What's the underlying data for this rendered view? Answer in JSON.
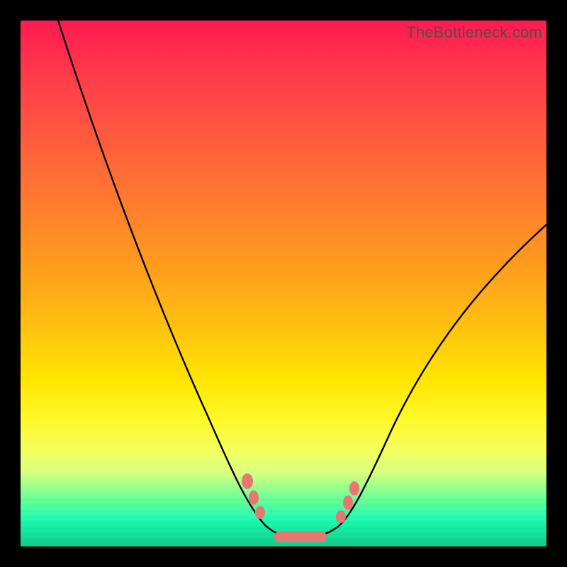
{
  "watermark": "TheBottleneck.com",
  "chart_data": {
    "type": "line",
    "title": "",
    "xlabel": "",
    "ylabel": "",
    "xlim": [
      0,
      100
    ],
    "ylim": [
      0,
      100
    ],
    "grid": false,
    "legend": false,
    "series": [
      {
        "name": "bottleneck-curve",
        "x": [
          7,
          10,
          14,
          18,
          22,
          26,
          30,
          34,
          38,
          41,
          43.5,
          46,
          49,
          52,
          55,
          58,
          61,
          63,
          66,
          70,
          75,
          80,
          85,
          90,
          95,
          100
        ],
        "y": [
          100,
          92,
          83.5,
          75,
          66,
          57,
          48,
          39,
          30,
          21,
          13,
          6.5,
          2.5,
          1.5,
          1.5,
          2.5,
          5,
          9,
          15,
          22,
          30,
          37,
          43.5,
          50,
          56,
          61.5
        ]
      }
    ],
    "markers": {
      "left_cluster_x": [
        43.2,
        44.3,
        45.3
      ],
      "left_cluster_y": [
        12.5,
        9.0,
        6.0
      ],
      "right_cluster_x": [
        60.8,
        62.0,
        63.2
      ],
      "right_cluster_y": [
        5.5,
        8.2,
        10.8
      ],
      "trough": {
        "x_start": 48.5,
        "x_end": 58.0,
        "y": 1.7
      }
    },
    "gradient_stops": [
      {
        "pos": 0,
        "color": "#ff1a52"
      },
      {
        "pos": 0.46,
        "color": "#ff9a1e"
      },
      {
        "pos": 0.76,
        "color": "#fff92a"
      },
      {
        "pos": 0.92,
        "color": "#4dffa0"
      },
      {
        "pos": 1.0,
        "color": "#10ca8d"
      }
    ]
  }
}
